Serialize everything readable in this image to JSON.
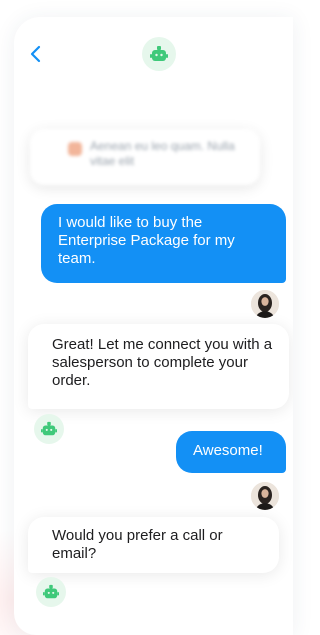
{
  "header": {
    "back_icon": "chevron-left-icon",
    "bot_icon": "robot-icon"
  },
  "colors": {
    "accent": "#1390f5",
    "bot_green": "#3fc97a",
    "bot_bg": "#e6f7ec"
  },
  "messages": [
    {
      "sender": "bot",
      "blurred": true,
      "text": "Aenean eu leo quam. Nulla vitae elit"
    },
    {
      "sender": "user",
      "text": "I would like to buy the Enterprise Package for my team."
    },
    {
      "sender": "bot",
      "text": "Great! Let me connect you with a salesperson to complete your order."
    },
    {
      "sender": "user",
      "text": "Awesome!"
    },
    {
      "sender": "bot",
      "text": "Would you prefer a call or email?"
    }
  ]
}
